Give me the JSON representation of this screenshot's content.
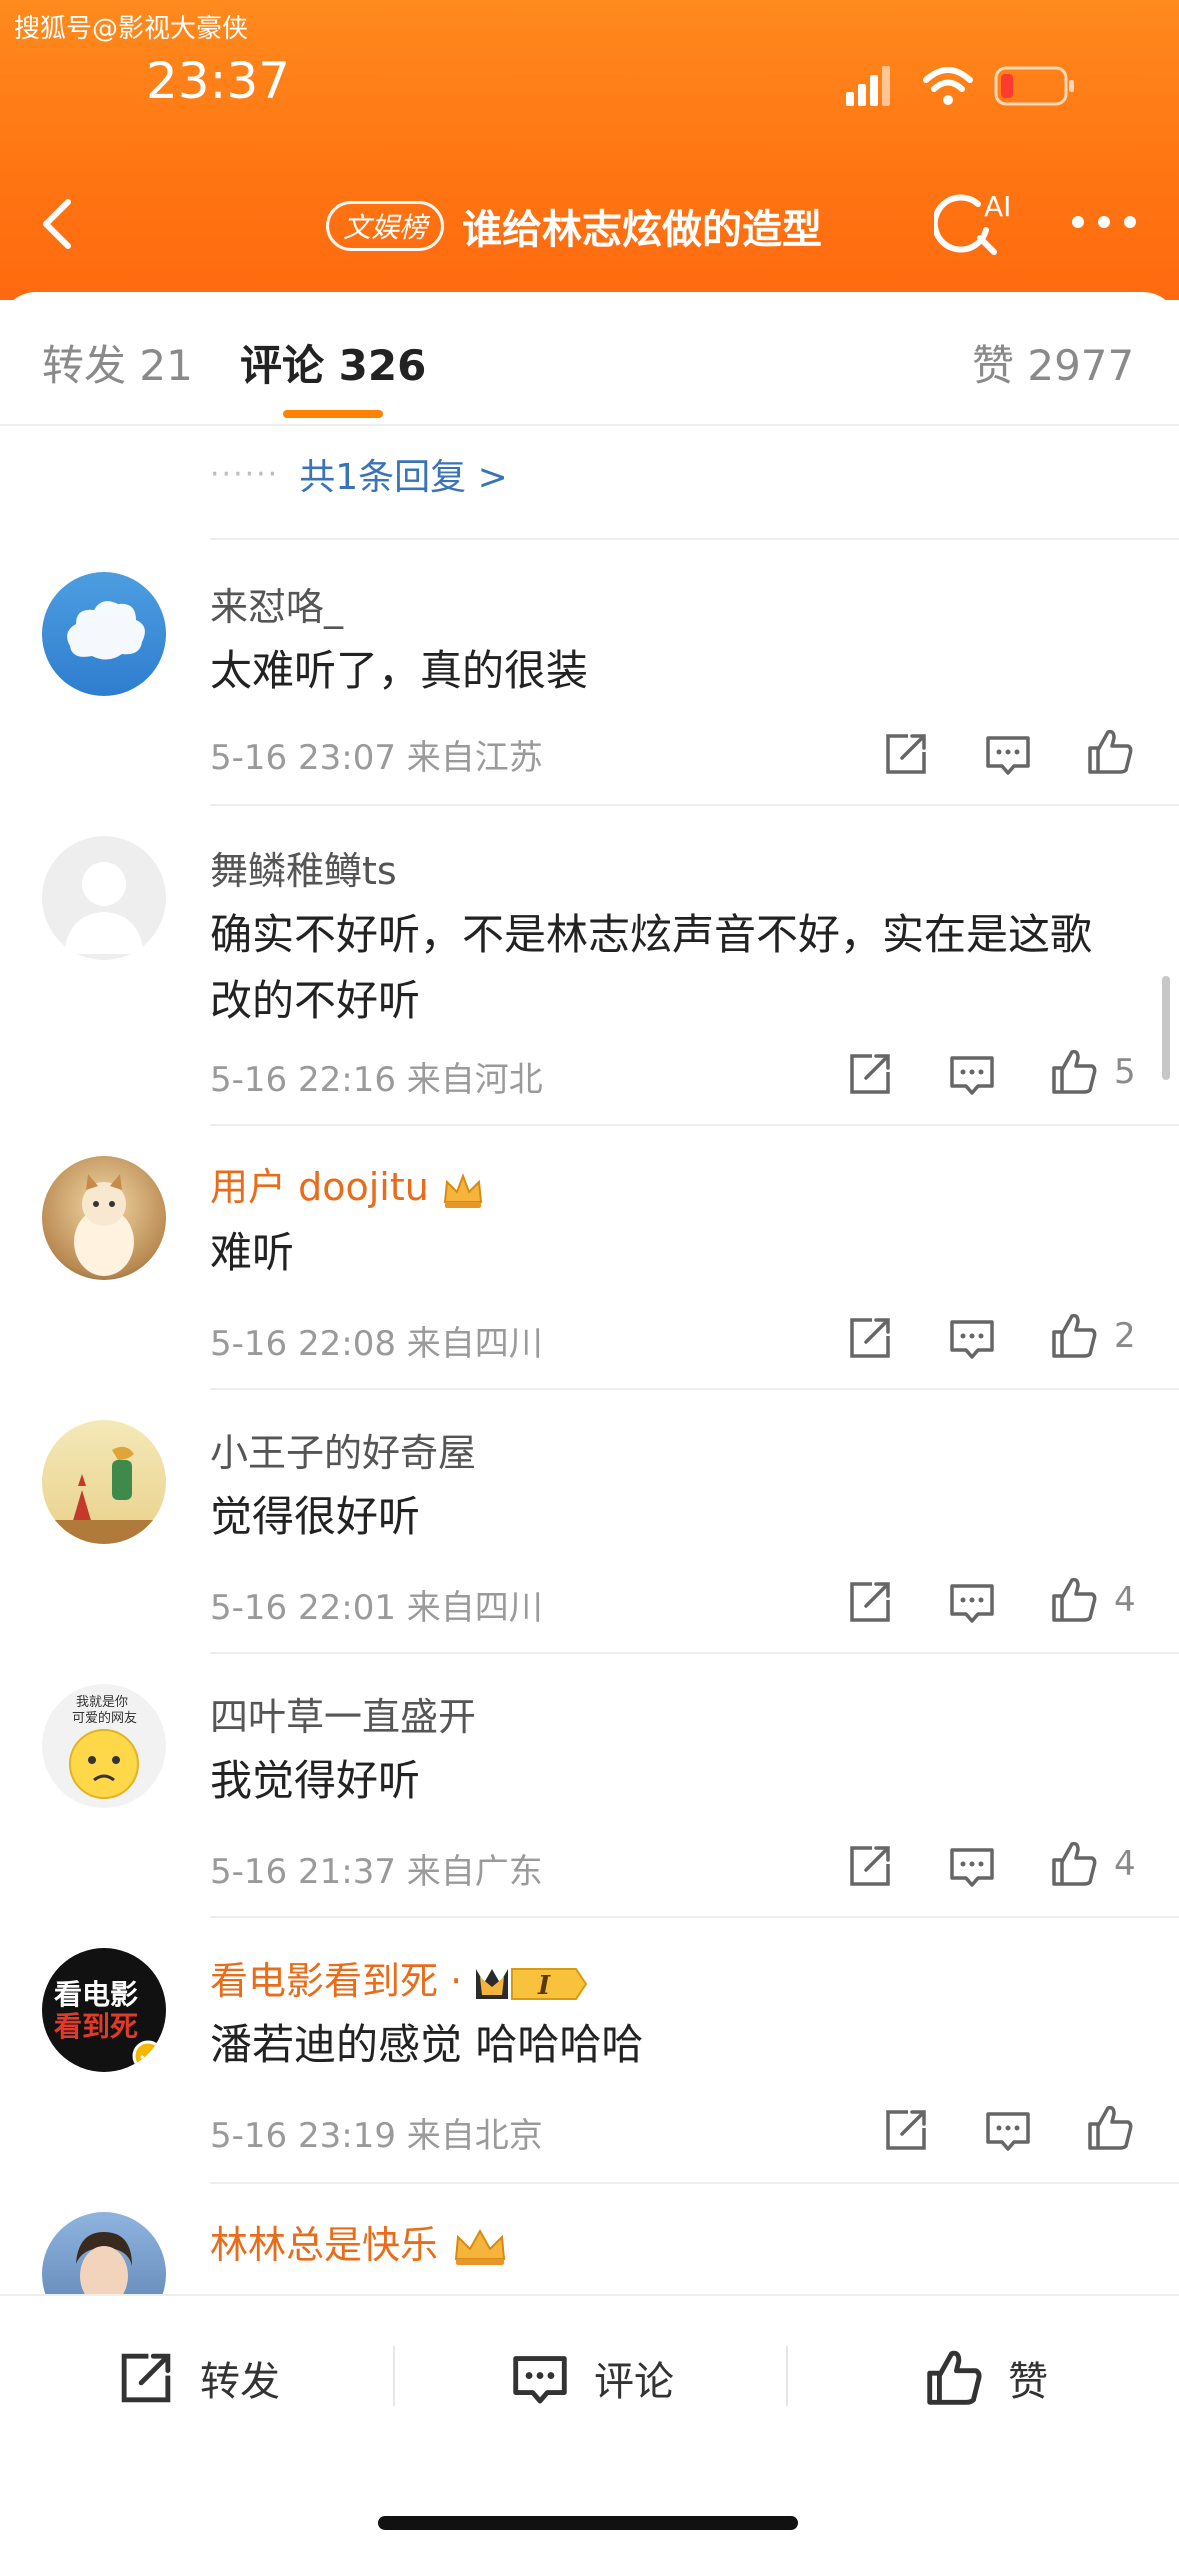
{
  "watermark": "搜狐号@影视大豪侠",
  "status": {
    "time": "23:37"
  },
  "nav": {
    "tag": "文娱榜",
    "title": "谁给林志炫做的造型",
    "ai_label": "AI"
  },
  "tabs": [
    {
      "label": "转发 21"
    },
    {
      "label": "评论 326"
    },
    {
      "label": "赞 2977"
    }
  ],
  "more_replies": {
    "dots": "······",
    "text": "共1条回复 >"
  },
  "comments": [
    {
      "user": "来怼咯_",
      "text": "太难听了，真的很装",
      "meta": "5-16 23:07 来自江苏",
      "likes": ""
    },
    {
      "user": "舞鳞稚鳟ts",
      "text": "确实不好听，不是林志炫声音不好，实在是这歌改的不好听",
      "meta": "5-16 22:16 来自河北",
      "likes": "5"
    },
    {
      "user": "用户 doojitu",
      "text": "难听",
      "meta": "5-16 22:08 来自四川",
      "likes": "2"
    },
    {
      "user": "小王子的好奇屋",
      "text": "觉得很好听",
      "meta": "5-16 22:01 来自四川",
      "likes": "4"
    },
    {
      "user": "四叶草一直盛开",
      "text": "我觉得好听",
      "meta": "5-16 21:37 来自广东",
      "likes": "4"
    },
    {
      "user": "看电影看到死 ·",
      "text": "潘若迪的感觉 哈哈哈哈",
      "meta": "5-16 23:19 来自北京",
      "likes": ""
    },
    {
      "user": "林林总是快乐",
      "text": "",
      "meta": "",
      "likes": ""
    }
  ],
  "avatars": {
    "a4_text_1": "我就是你",
    "a4_text_2": "可爱的网友",
    "a5_text_1": "看电影",
    "a5_text_2": "看到死",
    "vip_badge": "I"
  },
  "bottom": {
    "repost": "转发",
    "comment": "评论",
    "like": "赞"
  },
  "colors": {
    "brand_orange": "#ff7a12",
    "link_blue": "#3a74b8",
    "vip_orange": "#e86c1a",
    "tab_underline": "#ff8200"
  }
}
